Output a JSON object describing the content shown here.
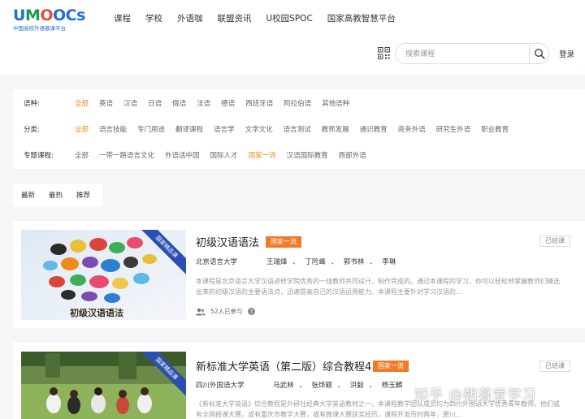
{
  "header": {
    "logo_word": "UMOOCs",
    "logo_sub": "中国高校外语慕课平台",
    "nav": [
      "课程",
      "学校",
      "外语咖",
      "联盟资讯",
      "U校园SPOC",
      "国家高教智慧平台"
    ],
    "search_placeholder": "搜索课程",
    "login": "登录"
  },
  "filters": [
    {
      "label": "语种:",
      "options": [
        "全部",
        "英语",
        "汉语",
        "日语",
        "俄语",
        "法语",
        "德语",
        "西班牙语",
        "阿拉伯语",
        "其他语种"
      ],
      "active": 0
    },
    {
      "label": "分类:",
      "options": [
        "全部",
        "语言技能",
        "专门用途",
        "翻译课程",
        "语言学",
        "文学文化",
        "语言测试",
        "教师发展",
        "通识教育",
        "商务外语",
        "研究生外语",
        "职业教育"
      ],
      "active": 0
    },
    {
      "label": "专题课程:",
      "options": [
        "全部",
        "一带一路语言文化",
        "外语话中国",
        "国际人才",
        "国家一流",
        "汉语国际教育",
        "西部外语"
      ],
      "active": 4
    }
  ],
  "sort_tabs": [
    "最新",
    "最热",
    "推荐"
  ],
  "courses": [
    {
      "title": "初级汉语语法",
      "badge": "国家一流",
      "status": "已结课",
      "school": "北京语言大学",
      "teachers": "王瑞烽 、 丁险峰 、 郭书林 、 李琳",
      "desc": "本课程是北京语言大学汉语进修学院优秀的一线教师共同设计、制作完成的。通过本课程的学习，你可以轻松地掌握教师们精选出来的初级汉语的主要语法点，迅速提高自己的汉语运用能力。本课程主要针对学习汉语的...",
      "count": "52人已参与",
      "ribbon": "国家精品课",
      "thumb_caption": "初级汉语语法"
    },
    {
      "title": "新标准大学英语（第二版）综合教程4",
      "badge": "国家一流",
      "status": "已结课",
      "school": "四川外国语大学",
      "teachers": "马武林 、 张烨颖 、 洪毅 、 杨玉麟",
      "desc": "《新标准大学英语》综合教程是外研社经典大学英语教材之一。本课程教学团队成员均为四川外国语大学优秀青年教师。他们或有全国授课大赛，或有重庆市教学大赛，或有微课大赛获奖经历。课程开发历时两年，原川...",
      "ribbon": "国家精品课"
    }
  ],
  "watermark": "知乎 @朝暮爱学习",
  "colors": {
    "accent": "#f08a1a",
    "badge": "#f07a25",
    "brand": "#1f6fd8",
    "ribbon": "#2a4fb0"
  }
}
